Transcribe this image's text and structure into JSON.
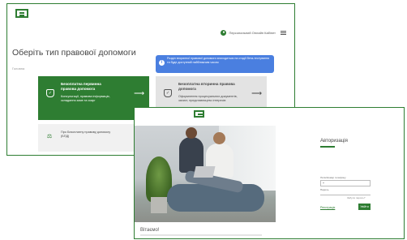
{
  "screen1": {
    "cabinet_label": "Персональний Онлайн Кабінет",
    "page_title": "Оберіть тип правової допомоги",
    "breadcrumb": "Головна",
    "info_text": "Розділ вторинної правової допомоги знаходиться на стадії бета-тестування та буде доступний найближчим часом",
    "cards": [
      {
        "title": "Безоплатна первинна правова допомога",
        "desc": "Консультації, правова інформація, складання заяв та скарг"
      },
      {
        "title": "Безоплатна вторинна правова допомога",
        "desc": "Оформлення процесуальних документів, захист, представництво інтересів"
      },
      {
        "title": "Про Безоплатну правову допомогу (БПД)"
      }
    ]
  },
  "screen2": {
    "welcome": "Вітаємо!",
    "auth_title": "Авторизація",
    "login_label": "Логін/Номер телефону",
    "login_value": "+",
    "password_label": "Пароль",
    "forgot_link": "Забули пароль?",
    "register_link": "Реєстрація",
    "login_button": "Увійти"
  },
  "colors": {
    "brand": "#2e7d32",
    "info": "#4a7fe0"
  },
  "icons": [
    "logo-icon",
    "user-icon",
    "menu-icon",
    "info-icon",
    "shield-icon",
    "arrow-right-icon",
    "scales-icon"
  ]
}
